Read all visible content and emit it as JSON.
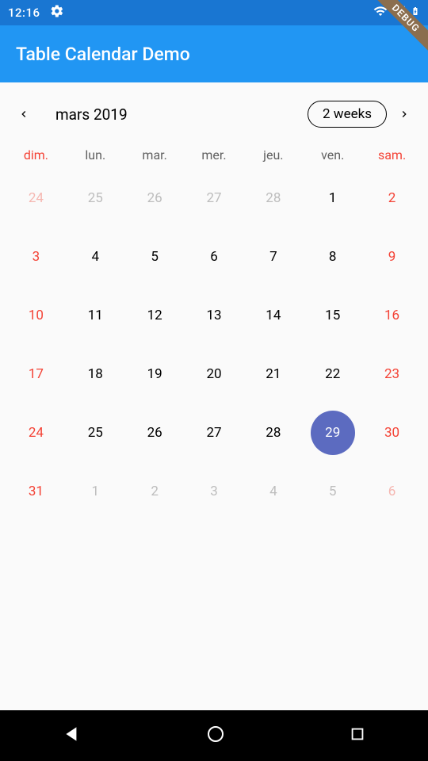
{
  "status": {
    "time": "12:16"
  },
  "debug_banner": "DEBUG",
  "app_bar": {
    "title": "Table Calendar Demo"
  },
  "header": {
    "month_label": "mars 2019",
    "view_toggle_label": "2 weeks"
  },
  "weekdays": [
    {
      "label": "dim.",
      "weekend": true
    },
    {
      "label": "lun.",
      "weekend": false
    },
    {
      "label": "mar.",
      "weekend": false
    },
    {
      "label": "mer.",
      "weekend": false
    },
    {
      "label": "jeu.",
      "weekend": false
    },
    {
      "label": "ven.",
      "weekend": false
    },
    {
      "label": "sam.",
      "weekend": true
    }
  ],
  "days": [
    {
      "n": "24",
      "col": 0,
      "outside": true,
      "today": false
    },
    {
      "n": "25",
      "col": 1,
      "outside": true,
      "today": false
    },
    {
      "n": "26",
      "col": 2,
      "outside": true,
      "today": false
    },
    {
      "n": "27",
      "col": 3,
      "outside": true,
      "today": false
    },
    {
      "n": "28",
      "col": 4,
      "outside": true,
      "today": false
    },
    {
      "n": "1",
      "col": 5,
      "outside": false,
      "today": false
    },
    {
      "n": "2",
      "col": 6,
      "outside": false,
      "today": false
    },
    {
      "n": "3",
      "col": 0,
      "outside": false,
      "today": false
    },
    {
      "n": "4",
      "col": 1,
      "outside": false,
      "today": false
    },
    {
      "n": "5",
      "col": 2,
      "outside": false,
      "today": false
    },
    {
      "n": "6",
      "col": 3,
      "outside": false,
      "today": false
    },
    {
      "n": "7",
      "col": 4,
      "outside": false,
      "today": false
    },
    {
      "n": "8",
      "col": 5,
      "outside": false,
      "today": false
    },
    {
      "n": "9",
      "col": 6,
      "outside": false,
      "today": false
    },
    {
      "n": "10",
      "col": 0,
      "outside": false,
      "today": false
    },
    {
      "n": "11",
      "col": 1,
      "outside": false,
      "today": false
    },
    {
      "n": "12",
      "col": 2,
      "outside": false,
      "today": false
    },
    {
      "n": "13",
      "col": 3,
      "outside": false,
      "today": false
    },
    {
      "n": "14",
      "col": 4,
      "outside": false,
      "today": false
    },
    {
      "n": "15",
      "col": 5,
      "outside": false,
      "today": false
    },
    {
      "n": "16",
      "col": 6,
      "outside": false,
      "today": false
    },
    {
      "n": "17",
      "col": 0,
      "outside": false,
      "today": false
    },
    {
      "n": "18",
      "col": 1,
      "outside": false,
      "today": false
    },
    {
      "n": "19",
      "col": 2,
      "outside": false,
      "today": false
    },
    {
      "n": "20",
      "col": 3,
      "outside": false,
      "today": false
    },
    {
      "n": "21",
      "col": 4,
      "outside": false,
      "today": false
    },
    {
      "n": "22",
      "col": 5,
      "outside": false,
      "today": false
    },
    {
      "n": "23",
      "col": 6,
      "outside": false,
      "today": false
    },
    {
      "n": "24",
      "col": 0,
      "outside": false,
      "today": false
    },
    {
      "n": "25",
      "col": 1,
      "outside": false,
      "today": false
    },
    {
      "n": "26",
      "col": 2,
      "outside": false,
      "today": false
    },
    {
      "n": "27",
      "col": 3,
      "outside": false,
      "today": false
    },
    {
      "n": "28",
      "col": 4,
      "outside": false,
      "today": false
    },
    {
      "n": "29",
      "col": 5,
      "outside": false,
      "today": true
    },
    {
      "n": "30",
      "col": 6,
      "outside": false,
      "today": false
    },
    {
      "n": "31",
      "col": 0,
      "outside": false,
      "today": false
    },
    {
      "n": "1",
      "col": 1,
      "outside": true,
      "today": false
    },
    {
      "n": "2",
      "col": 2,
      "outside": true,
      "today": false
    },
    {
      "n": "3",
      "col": 3,
      "outside": true,
      "today": false
    },
    {
      "n": "4",
      "col": 4,
      "outside": true,
      "today": false
    },
    {
      "n": "5",
      "col": 5,
      "outside": true,
      "today": false
    },
    {
      "n": "6",
      "col": 6,
      "outside": true,
      "today": false
    }
  ]
}
